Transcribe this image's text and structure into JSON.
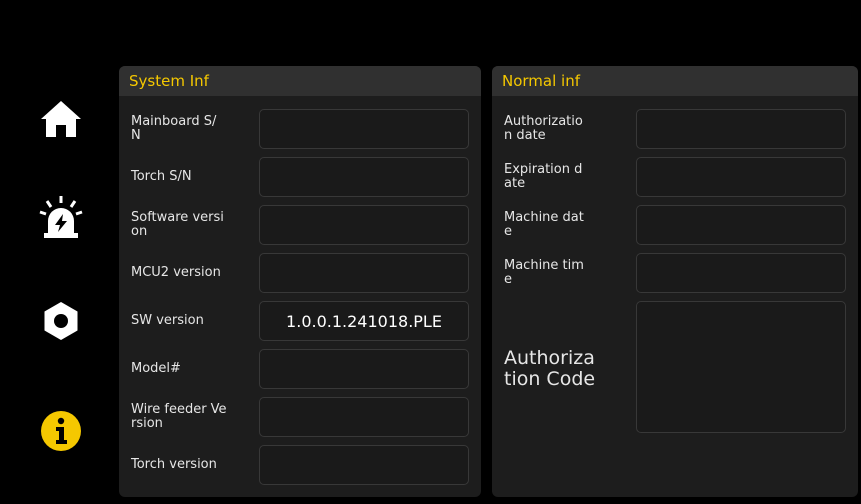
{
  "nav": {
    "items": [
      {
        "icon": "home-icon",
        "color": "#ffffff"
      },
      {
        "icon": "alarm-icon",
        "color": "#ffffff"
      },
      {
        "icon": "gear-icon",
        "color": "#ffffff"
      },
      {
        "icon": "info-icon",
        "color": "#f5c800",
        "active": true
      }
    ]
  },
  "system_panel": {
    "title": "System Inf",
    "rows": [
      {
        "label": "Mainboard S/\nN",
        "value": ""
      },
      {
        "label": "Torch S/N",
        "value": ""
      },
      {
        "label": "Software versi\non",
        "value": ""
      },
      {
        "label": "MCU2 version",
        "value": ""
      },
      {
        "label": "SW version",
        "value": "1.0.0.1.241018.PLE"
      },
      {
        "label": "Model#",
        "value": ""
      },
      {
        "label": "Wire feeder Ve\nrsion",
        "value": ""
      },
      {
        "label": "Torch version",
        "value": ""
      }
    ]
  },
  "normal_panel": {
    "title": "Normal inf",
    "rows": [
      {
        "label": "Authorizatio\nn date",
        "value": ""
      },
      {
        "label": "Expiration d\nate",
        "value": ""
      },
      {
        "label": "Machine dat\ne",
        "value": ""
      },
      {
        "label": "Machine tim\ne",
        "value": ""
      }
    ],
    "auth_code_label": "Authoriza\ntion Code",
    "auth_code_value": ""
  },
  "colors": {
    "accent": "#f5c800",
    "panel": "#1d1d1d",
    "header": "#303030"
  }
}
